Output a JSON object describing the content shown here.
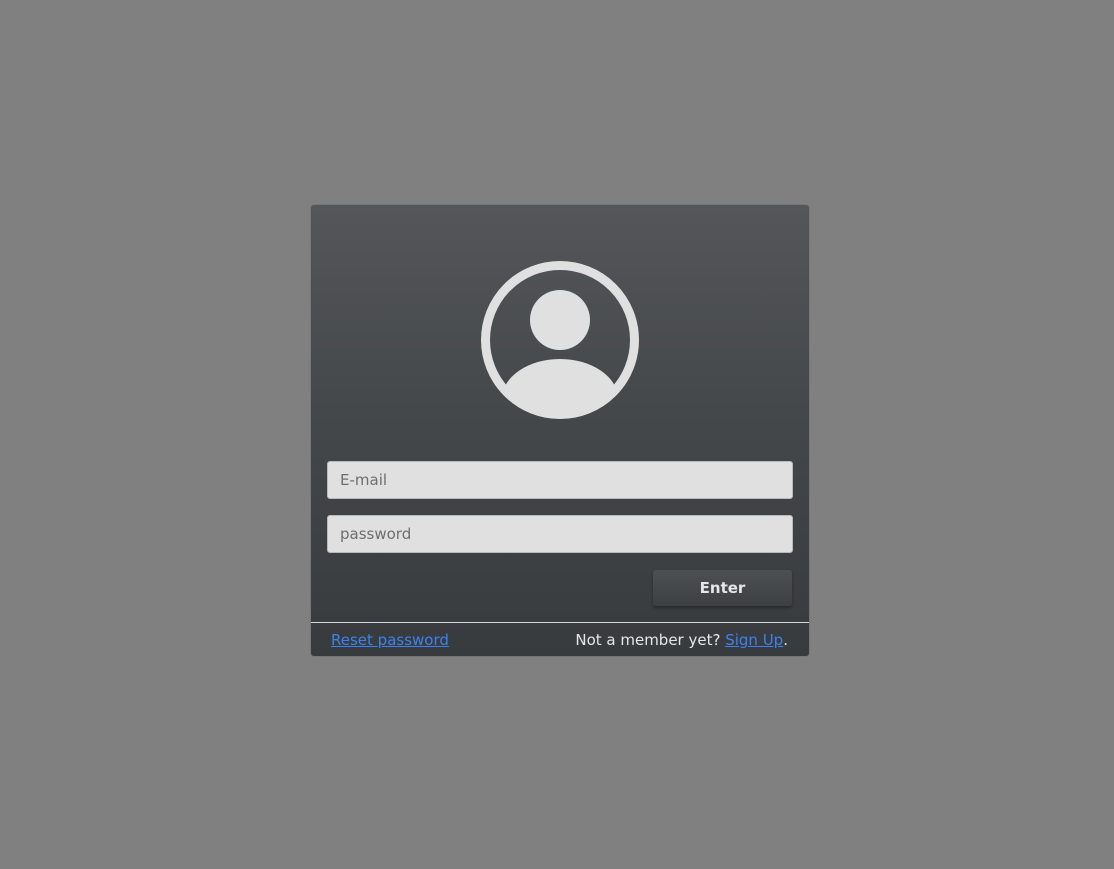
{
  "colors": {
    "background": "#808080",
    "panel_top": "#545658",
    "panel_bottom": "#383b3e",
    "field_bg": "#e0e0e0",
    "link": "#3b82f0",
    "avatar": "#e0e0e0"
  },
  "avatar": {
    "icon": "user-circle-icon"
  },
  "form": {
    "email_placeholder": "E-mail",
    "email_value": "",
    "password_placeholder": "password",
    "password_value": "",
    "enter_label": "Enter"
  },
  "footer": {
    "reset_label": "Reset password",
    "signup_prompt": "Not a member yet? ",
    "signup_label": "Sign Up",
    "signup_suffix": "."
  }
}
